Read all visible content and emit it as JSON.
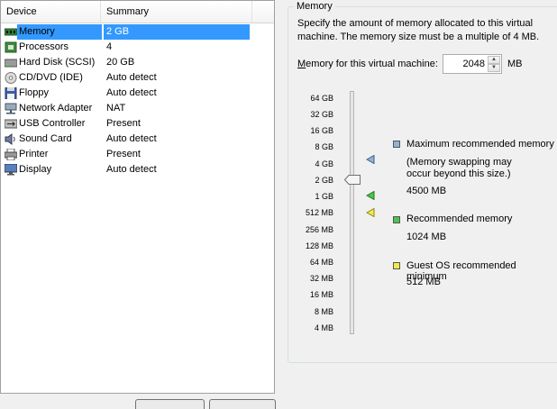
{
  "device_list": {
    "columns": {
      "device": "Device",
      "summary": "Summary"
    },
    "rows": [
      {
        "icon": "memory-icon",
        "device": "Memory",
        "summary": "2 GB",
        "selected": true
      },
      {
        "icon": "processor-icon",
        "device": "Processors",
        "summary": "4"
      },
      {
        "icon": "hard-disk-icon",
        "device": "Hard Disk (SCSI)",
        "summary": "20 GB"
      },
      {
        "icon": "cd-dvd-icon",
        "device": "CD/DVD (IDE)",
        "summary": "Auto detect"
      },
      {
        "icon": "floppy-icon",
        "device": "Floppy",
        "summary": "Auto detect"
      },
      {
        "icon": "network-adapter-icon",
        "device": "Network Adapter",
        "summary": "NAT"
      },
      {
        "icon": "usb-controller-icon",
        "device": "USB Controller",
        "summary": "Present"
      },
      {
        "icon": "sound-card-icon",
        "device": "Sound Card",
        "summary": "Auto detect"
      },
      {
        "icon": "printer-icon",
        "device": "Printer",
        "summary": "Present"
      },
      {
        "icon": "display-icon",
        "device": "Display",
        "summary": "Auto detect"
      }
    ]
  },
  "memory": {
    "group_title": "Memory",
    "description": "Specify the amount of memory allocated to this virtual machine. The memory size must be a multiple of 4 MB.",
    "field_label_prefix": "",
    "field_label_accel": "M",
    "field_label_rest": "emory for this virtual machine:",
    "value": "2048",
    "unit": "MB",
    "scale_labels": [
      "64 GB",
      "32 GB",
      "16 GB",
      "8 GB",
      "4 GB",
      "2 GB",
      "1 GB",
      "512 MB",
      "256 MB",
      "128 MB",
      "64 MB",
      "32 MB",
      "16 MB",
      "8 MB",
      "4 MB"
    ],
    "legend": {
      "max": {
        "title": "Maximum recommended memory",
        "note_line1": "(Memory swapping may",
        "note_line2": "occur beyond this size.)",
        "value": "4500 MB",
        "color": "#7fa6c9"
      },
      "recommended": {
        "title": "Recommended memory",
        "value": "1024 MB",
        "color": "#3cb23c"
      },
      "guest_min": {
        "title": "Guest OS recommended minimum",
        "value": "512 MB",
        "color": "#f0e040"
      }
    }
  }
}
